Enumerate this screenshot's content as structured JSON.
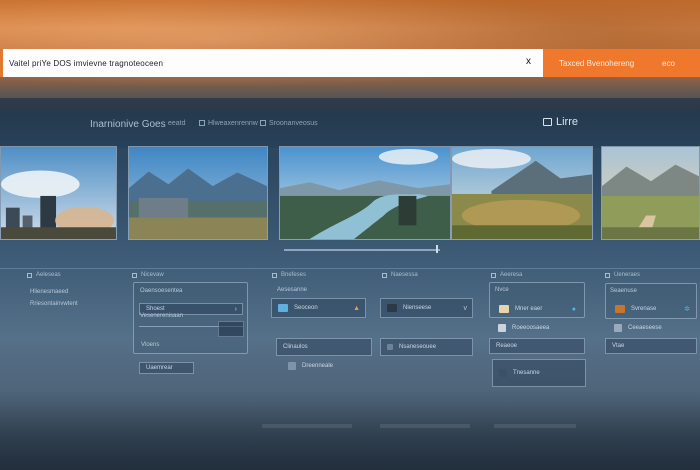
{
  "browser": {
    "address_text": "Vaitel priYe DOS imvievne tragnoteoceen",
    "close_glyph": "x",
    "panel_label": "Taxced Bvenohereng",
    "panel_right": "eco"
  },
  "app": {
    "title": "Inarnionive Goes",
    "sub1": "eeatd",
    "sub2": "Hlweaxenrennw",
    "sub3": "Sroonanveosus",
    "right_label": "Lirre"
  },
  "gallery": {
    "thumbnails": [
      {
        "name": "city-fog"
      },
      {
        "name": "mountain-lake"
      },
      {
        "name": "river-valley"
      },
      {
        "name": "volcano-meadow"
      },
      {
        "name": "desert-road"
      }
    ],
    "scroll_position": 0.98
  },
  "columns": [
    {
      "header": "Aeleseas",
      "line1": "Hlienesmaeed",
      "line2": "Rriesontainvwtent"
    },
    {
      "header": "Nicevaw",
      "card_title": "Oaensoesentea",
      "field1": "Shoest",
      "field2": "Vesenerenisaan",
      "footer": "Vloens",
      "footer2": "Uaemrear"
    },
    {
      "header": "Bnefeses",
      "sub": "Aesesanne",
      "field1": "Seoceon",
      "field2": "Clinaulos",
      "footer": "Dreenneale",
      "accent": "#5fb0e0"
    },
    {
      "header": "Naesessa",
      "field1": "Nienseese",
      "field2": "Nsaneseouee",
      "dropdown": "v"
    },
    {
      "header": "Aeeresa",
      "sub": "Nvce",
      "field1": "Mner eaer",
      "field2": "Roeeoosaeea",
      "footer": "Reaeoe",
      "footer2": "Tnesanne"
    },
    {
      "header": "Ueneraes",
      "sub": "Seaenuse",
      "field1": "Svrenase",
      "field2": "Ceeaeseese",
      "footer": "Vtae"
    }
  ]
}
